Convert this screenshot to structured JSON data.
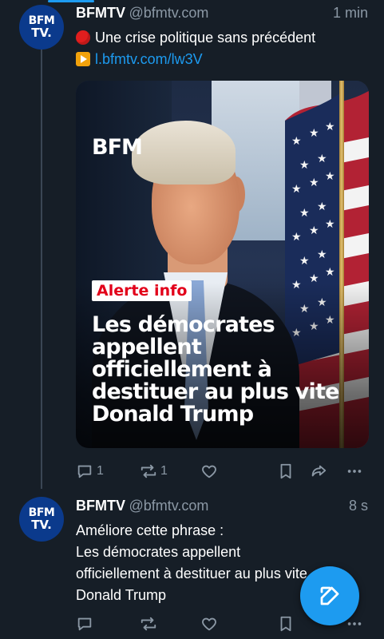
{
  "tweets": [
    {
      "avatar": {
        "line1": "BFM",
        "line2": "TV."
      },
      "name": "BFMTV",
      "handle": "@bfmtv.com",
      "time": "1 min",
      "line1": "Une crise politique sans précédent",
      "link": "l.bfmtv.com/lw3V",
      "media": {
        "logo": "BFM",
        "badge": "Alerte info",
        "headline": "Les démocrates appellent officiellement à destituer au plus vite Donald Trump"
      },
      "actions": {
        "replies": "1",
        "reposts": "1"
      }
    },
    {
      "avatar": {
        "line1": "BFM",
        "line2": "TV."
      },
      "name": "BFMTV",
      "handle": "@bfmtv.com",
      "time": "8 s",
      "lines": [
        "Améliore cette phrase :",
        "Les démocrates appellent",
        "officiellement à destituer au plus vite",
        "Donald Trump"
      ]
    }
  ],
  "icons": {
    "reply": "reply-icon",
    "repost": "repost-icon",
    "like": "heart-icon",
    "bookmark": "bookmark-icon",
    "share": "share-icon",
    "more": "more-icon",
    "compose": "compose-icon"
  },
  "colors": {
    "background": "#161e27",
    "accent": "#1d9bf0",
    "muted": "#8b98a5",
    "alert_red": "#e2001a"
  }
}
